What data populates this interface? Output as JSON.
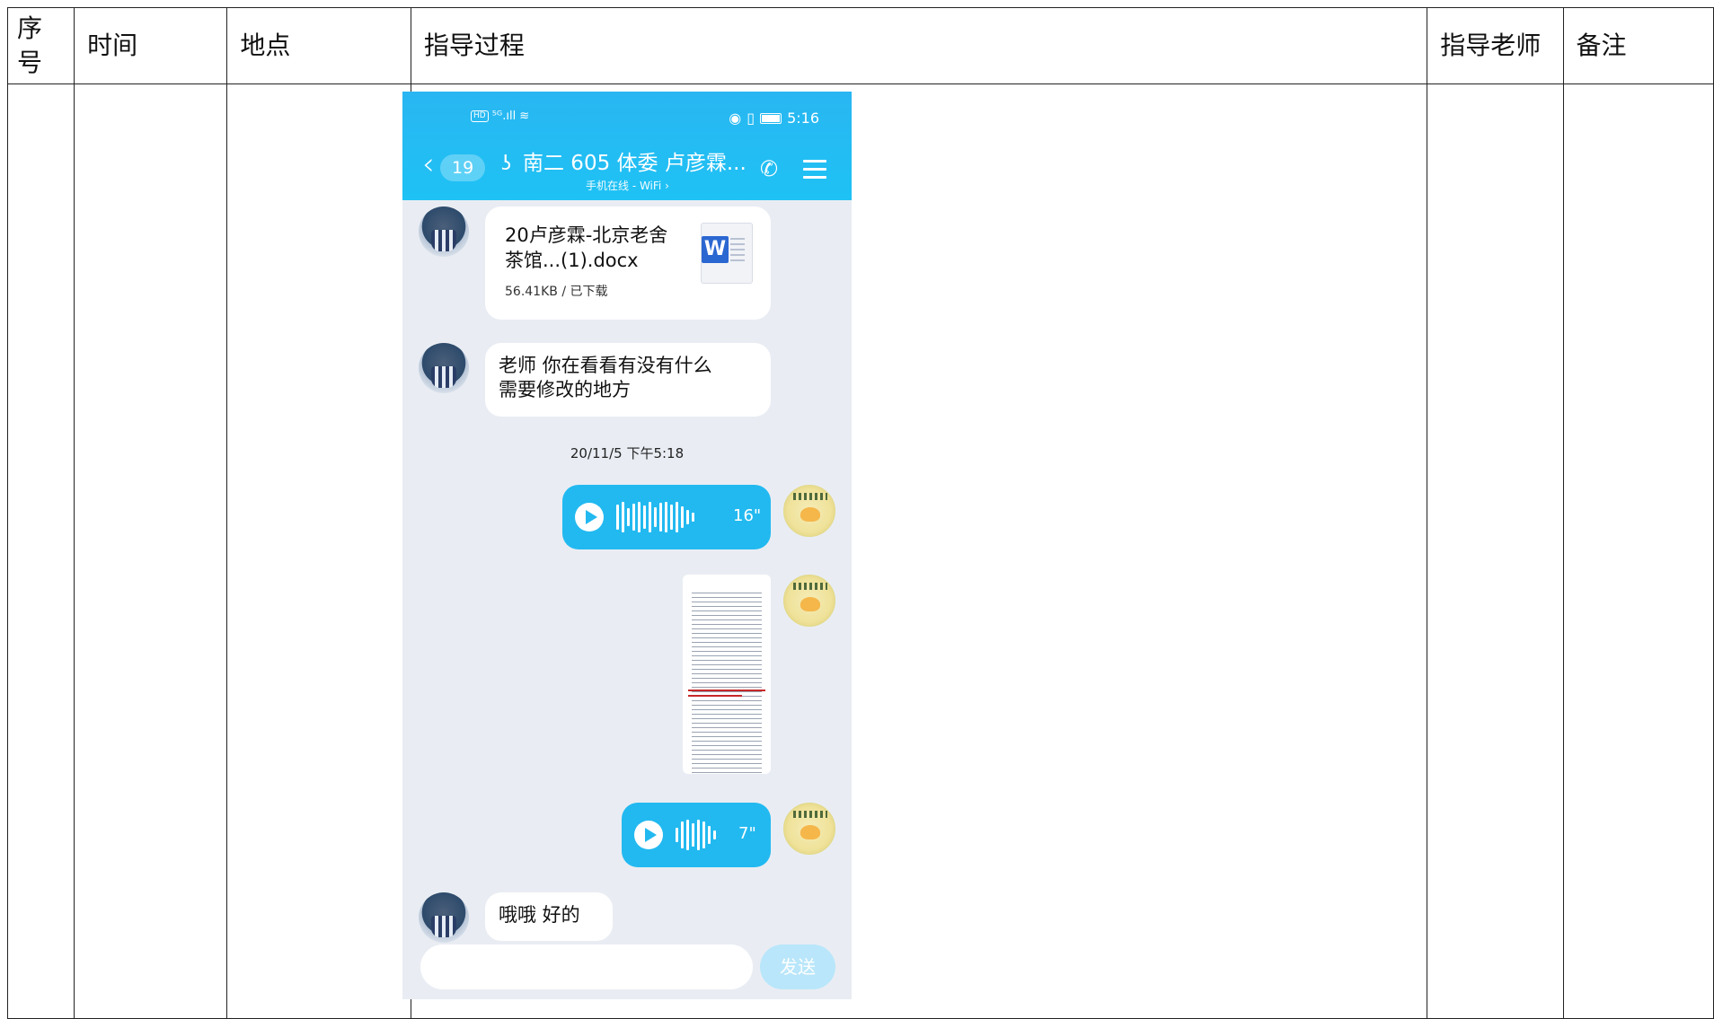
{
  "table": {
    "headers": {
      "seq": [
        "序",
        "号"
      ],
      "time": "时间",
      "place": "地点",
      "process": "指导过程",
      "teacher": "指导老师",
      "remark": "备注"
    }
  },
  "chat": {
    "status": {
      "network": "⁵ᴳ.ıll",
      "time": "5:16"
    },
    "unread_count": "19",
    "title": "南二 605 体委  卢彦霖...",
    "subtitle": "手机在线 - WiFi ›",
    "file": {
      "name": "20卢彦霖-北京老舍茶馆...(1).docx",
      "meta": "56.41KB / 已下载"
    },
    "msg1": "老师  你在看看有没有什么\n需要修改的地方",
    "timestamp": "20/11/5 下午5:18",
    "voice1": {
      "duration": "16\""
    },
    "voice2": {
      "duration": "7\""
    },
    "msg2": "哦哦  好的",
    "send_label": "发送"
  }
}
